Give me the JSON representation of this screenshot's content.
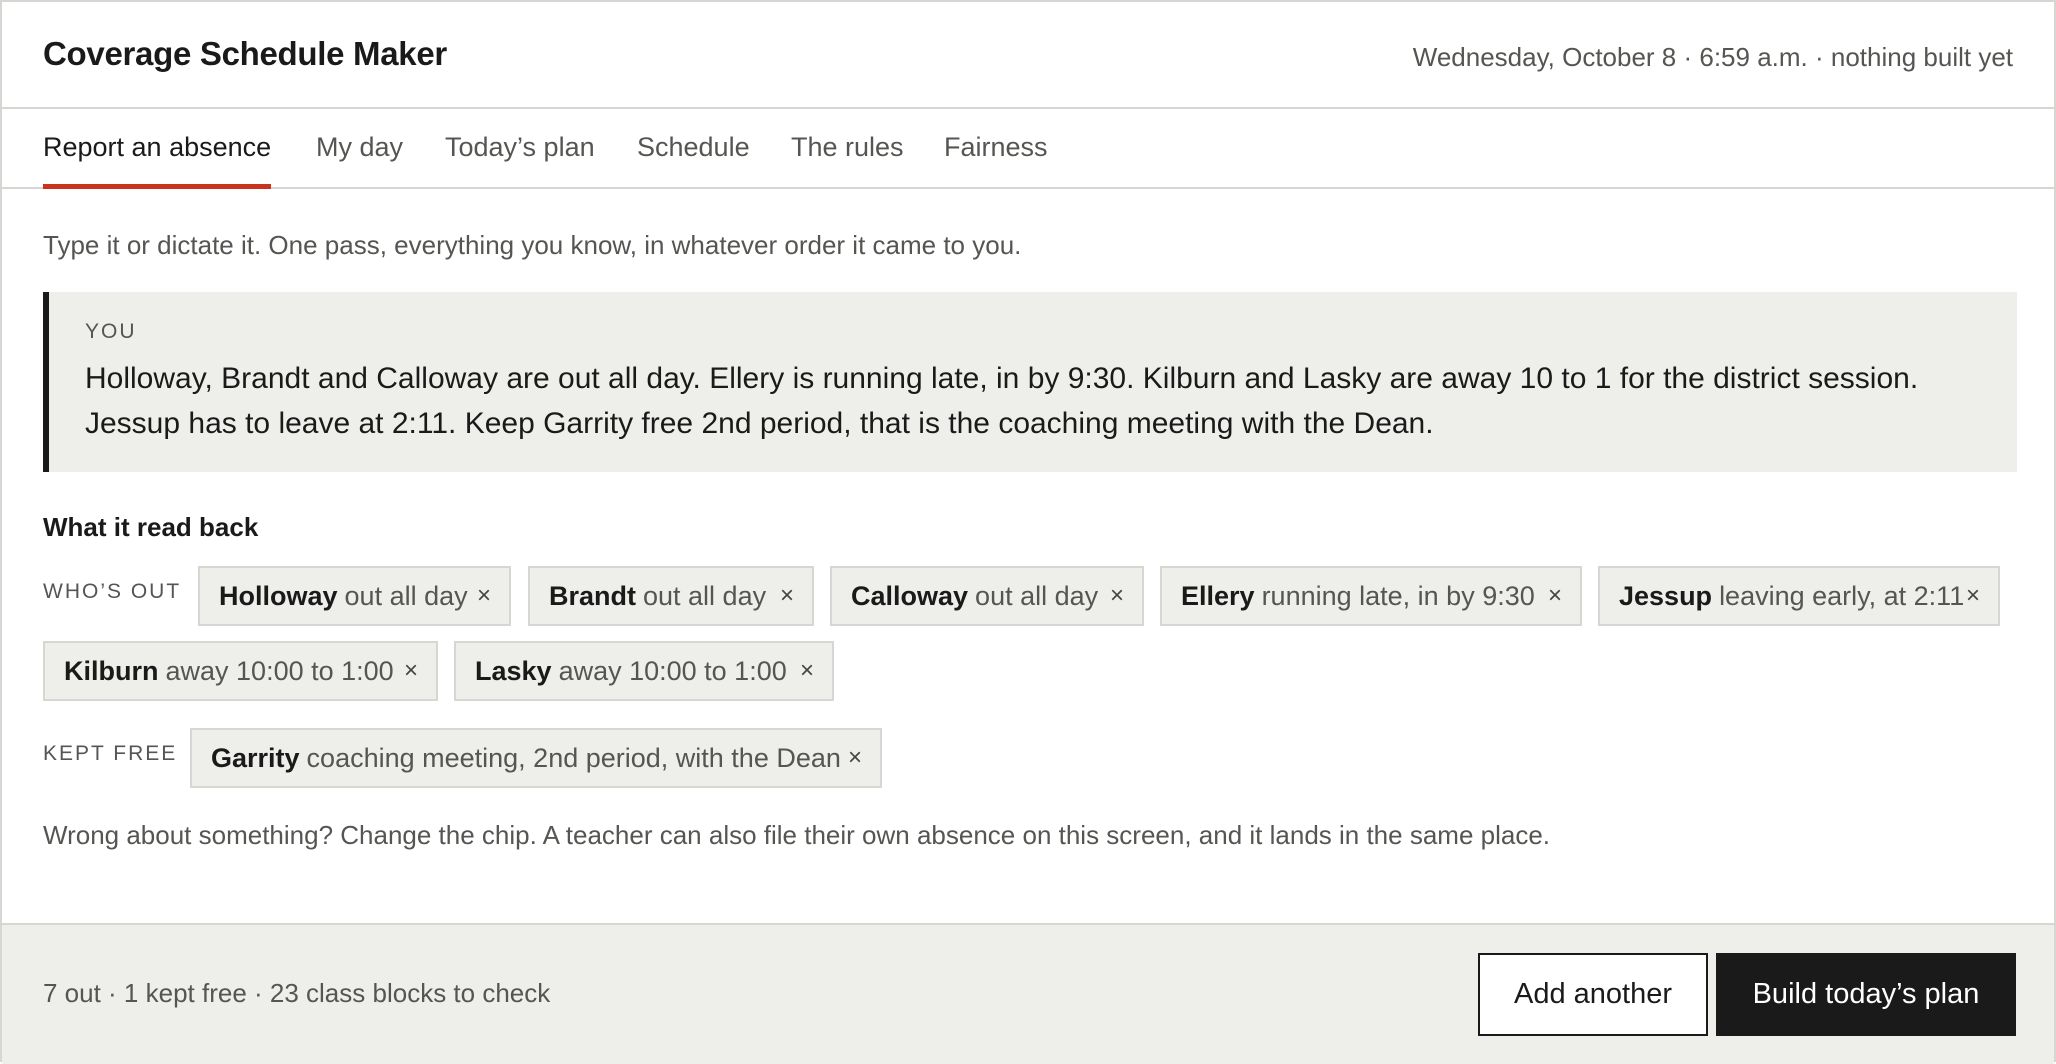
{
  "header": {
    "title": "Coverage Schedule Maker",
    "status": "Wednesday, October 8 · 6:59 a.m. · nothing built yet"
  },
  "tabs": [
    {
      "label": "Report an absence",
      "active": true
    },
    {
      "label": "My day",
      "active": false
    },
    {
      "label": "Today’s plan",
      "active": false
    },
    {
      "label": "Schedule",
      "active": false
    },
    {
      "label": "The rules",
      "active": false
    },
    {
      "label": "Fairness",
      "active": false
    }
  ],
  "intro": "Type it or dictate it. One pass, everything you know, in whatever order it came to you.",
  "you": {
    "label": "YOU",
    "text": "Holloway, Brandt and Calloway are out all day. Ellery is running late, in by 9:30. Kilburn and Lasky are away 10 to 1 for the district session. Jessup has to leave at 2:11. Keep Garrity free 2nd period, that is the coaching meeting with the Dean."
  },
  "readback": {
    "title": "What it read back",
    "whos_out_label": "WHO’S OUT",
    "kept_free_label": "KEPT FREE",
    "remove_glyph": "×",
    "out": [
      {
        "name": "Holloway",
        "detail": "out all day"
      },
      {
        "name": "Brandt",
        "detail": "out all day"
      },
      {
        "name": "Calloway",
        "detail": "out all day"
      },
      {
        "name": "Ellery",
        "detail": "running late, in by 9:30"
      },
      {
        "name": "Jessup",
        "detail": "leaving early, at 2:11"
      },
      {
        "name": "Kilburn",
        "detail": "away 10:00 to 1:00"
      },
      {
        "name": "Lasky",
        "detail": "away 10:00 to 1:00"
      }
    ],
    "kept_free": [
      {
        "name": "Garrity",
        "detail": "coaching meeting, 2nd period, with the Dean"
      }
    ]
  },
  "note": "Wrong about something? Change the chip. A teacher can also file their own absence on this screen, and it lands in the same place.",
  "footer": {
    "summary": "7 out · 1 kept free · 23 class blocks to check",
    "add_another": "Add another",
    "build_plan": "Build today’s plan"
  },
  "colors": {
    "accent": "#c8321e",
    "chip_bg": "#eeeeea",
    "border": "#d6d6d3",
    "ink": "#1a1a1a",
    "muted": "#555552"
  }
}
